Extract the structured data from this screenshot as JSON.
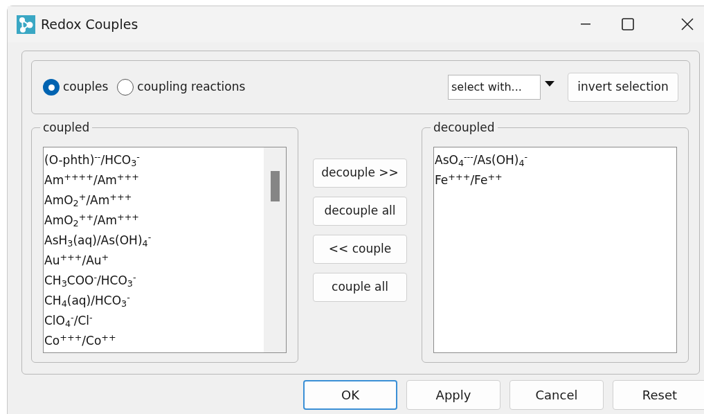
{
  "window": {
    "title": "Redox Couples"
  },
  "view_options": [
    {
      "label": "couples",
      "selected": true
    },
    {
      "label": "coupling reactions",
      "selected": false
    }
  ],
  "select_with": {
    "value": "select with..."
  },
  "invert_button": "invert selection",
  "coupled": {
    "title": "coupled",
    "items": [
      "(O-phth)$^{--}$/HCO$_{3}$$^{-}$",
      "Am$^{++++}$/Am$^{+++}$",
      "AmO$_{2}$$^{+}$/Am$^{+++}$",
      "AmO$_{2}$$^{++}$/Am$^{+++}$",
      "AsH$_{3}$(aq)/As(OH)$_{4}$$^{-}$",
      "Au$^{+++}$/Au$^{+}$",
      "CH$_{3}$COO$^{-}$/HCO$_{3}$$^{-}$",
      "CH$_{4}$(aq)/HCO$_{3}$$^{-}$",
      "ClO$_{4}$$^{-}$/Cl$^{-}$",
      "Co$^{+++}$/Co$^{++}$"
    ]
  },
  "move_buttons": [
    "decouple >>",
    "decouple all",
    "<< couple",
    "couple all"
  ],
  "decoupled": {
    "title": "decoupled",
    "items": [
      "AsO$_{4}$$^{---}$/As(OH)$_{4}$$^{-}$",
      "Fe$^{+++}$/Fe$^{++}$"
    ]
  },
  "dialog_buttons": [
    {
      "label": "OK",
      "kind": "default"
    },
    {
      "label": "Apply",
      "kind": "normal"
    },
    {
      "label": "Cancel",
      "kind": "normal"
    },
    {
      "label": "Reset",
      "kind": "normal"
    }
  ]
}
